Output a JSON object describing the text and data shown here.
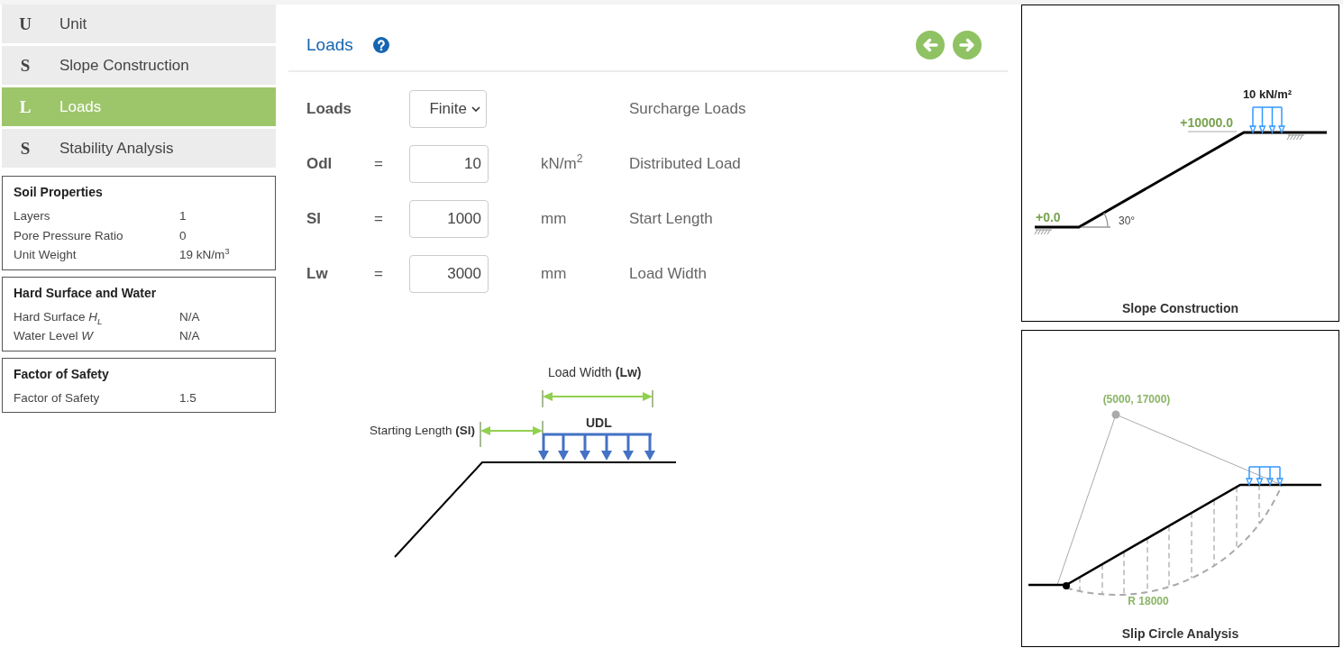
{
  "nav": [
    {
      "letter": "U",
      "label": "Unit",
      "selected": false
    },
    {
      "letter": "S",
      "label": "Slope Construction",
      "selected": false
    },
    {
      "letter": "L",
      "label": "Loads",
      "selected": true
    },
    {
      "letter": "S",
      "label": "Stability Analysis",
      "selected": false
    }
  ],
  "info_panels": [
    {
      "title": "Soil Properties",
      "rows": [
        {
          "label": "Layers",
          "value": "1"
        },
        {
          "label": "Pore Pressure Ratio",
          "value": "0"
        },
        {
          "label": "Unit Weight",
          "value": "19 kN/m$^{3}$"
        }
      ]
    },
    {
      "title": "Hard Surface and Water",
      "rows": [
        {
          "label": "Hard Surface *H*$_{L}$",
          "value": "N/A"
        },
        {
          "label": "Water Level *W*",
          "value": "N/A"
        }
      ]
    },
    {
      "title": "Factor of Safety",
      "rows": [
        {
          "label": "Factor of Safety",
          "value": "1.5"
        }
      ]
    }
  ],
  "main": {
    "title": "Loads"
  },
  "form": {
    "rows": [
      {
        "kind": "select",
        "label": "Loads",
        "value": "Finite",
        "description": "Surcharge Loads"
      },
      {
        "kind": "input",
        "label": "Odl",
        "operator": "=",
        "value": "10",
        "unit": "kN/m$^{2}$",
        "description": "Distributed Load"
      },
      {
        "kind": "input",
        "label": "Sl",
        "operator": "=",
        "value": "1000",
        "unit": "mm",
        "description": "Start Length"
      },
      {
        "kind": "input",
        "label": "Lw",
        "operator": "=",
        "value": "3000",
        "unit": "mm",
        "description": "Load Width"
      }
    ]
  },
  "load_diagram": {
    "width_label": "Load Width **(Lw)**",
    "load_label": "UDL",
    "start_label": "Starting Length **(Sl)**"
  },
  "previews": [
    {
      "kind": "slope",
      "load": "10 kN/m²",
      "top_level": "+10000.0",
      "bottom_level": "+0.0",
      "angle": "30°",
      "caption": "Slope Construction"
    },
    {
      "kind": "slip",
      "center": "(5000, 17000)",
      "radius": "R 18000",
      "caption": "Slip Circle Analysis"
    }
  ]
}
